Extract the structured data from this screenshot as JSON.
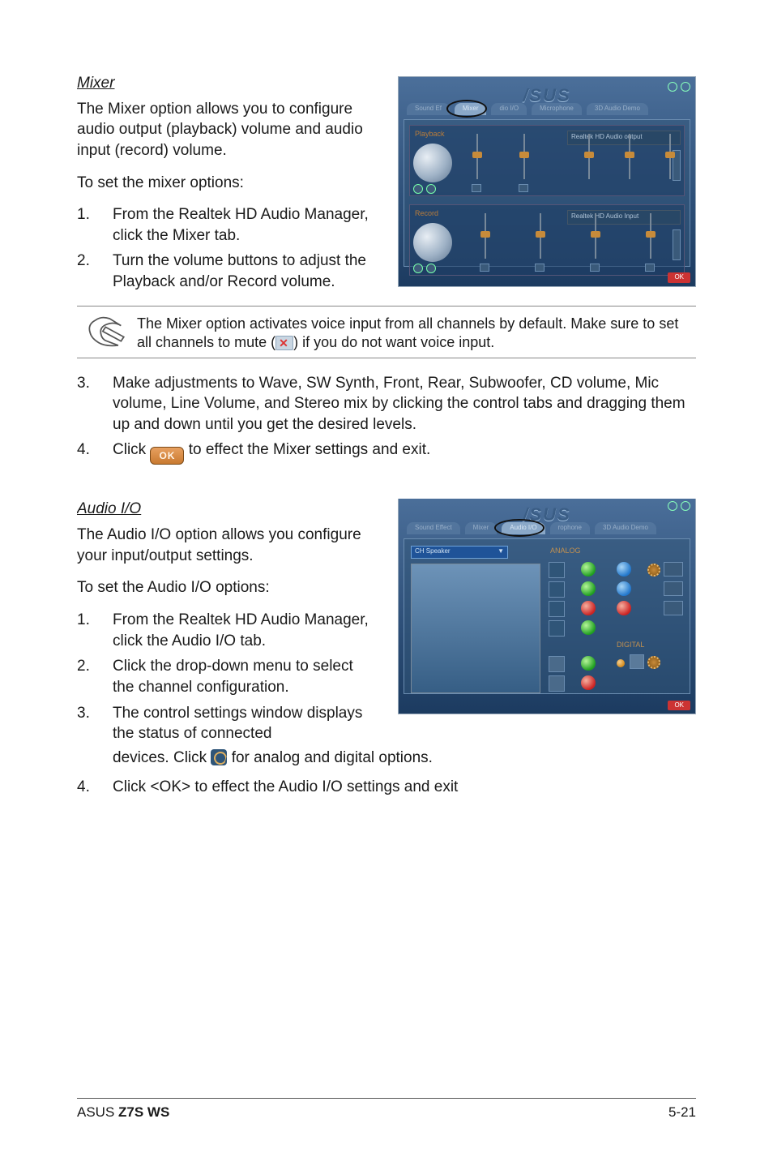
{
  "mixer": {
    "heading": "Mixer",
    "intro": "The Mixer option allows you to configure audio output (playback) volume and audio input (record) volume.",
    "pre_list": "To set the mixer options:",
    "steps12": [
      {
        "num": "1.",
        "text": "From the Realtek HD Audio Manager, click the Mixer tab."
      },
      {
        "num": "2.",
        "text": "Turn the volume buttons to adjust the Playback and/or Record volume."
      }
    ],
    "note_a": "The Mixer option activates voice input from all channels by default. Make sure to set all channels to mute (",
    "note_b": ") if you do not want voice input.",
    "steps34": [
      {
        "num": "3.",
        "text": "Make adjustments to Wave, SW Synth, Front, Rear, Subwoofer, CD volume, Mic volume, Line Volume, and Stereo mix by clicking the control tabs and dragging them up and down until you get the desired levels."
      },
      {
        "num": "4.",
        "pre": "Click ",
        "post": " to effect the Mixer settings and exit."
      }
    ],
    "ok_label": "OK"
  },
  "audioio": {
    "heading": "Audio I/O",
    "intro": "The Audio I/O option allows you configure your input/output settings.",
    "pre_list": "To set the Audio I/O options:",
    "steps": [
      {
        "num": "1.",
        "text": "From the Realtek HD Audio Manager, click the Audio I/O tab."
      },
      {
        "num": "2.",
        "text": "Click the drop-down menu to select the channel configuration."
      },
      {
        "num": "3.",
        "line1": "The control settings window displays the status of connected",
        "line2a": "devices. Click ",
        "line2b": " for analog and digital options."
      },
      {
        "num": "4.",
        "text": "Click <OK> to effect the Audio I/O settings and exit"
      }
    ]
  },
  "screenshots": {
    "logo": "/SUS",
    "s1": {
      "tabs": [
        "Sound Ef",
        "Mixer",
        "dio I/O",
        "Microphone",
        "3D Audio Demo"
      ],
      "row1_label": "Playback",
      "row1_box": "Realtek HD Audio output",
      "row2_label": "Record",
      "row2_box": "Realtek HD Audio Input"
    },
    "s2": {
      "tabs": [
        "Sound Effect",
        "Mixer",
        "Audio I/O",
        "rophone",
        "3D Audio Demo"
      ],
      "dropdown": "CH Speaker",
      "analog": "ANALOG",
      "digital": "DIGITAL"
    }
  },
  "footer": {
    "brand": "ASUS ",
    "model": "Z7S WS",
    "page": "5-21"
  }
}
